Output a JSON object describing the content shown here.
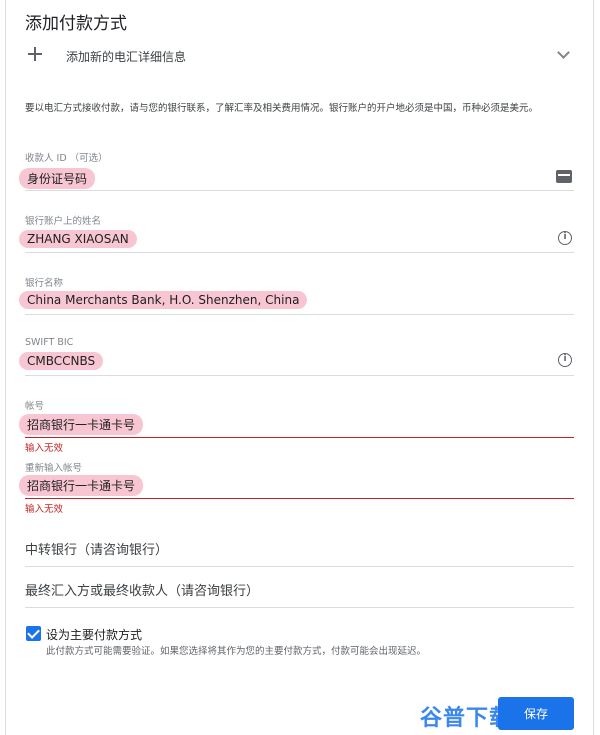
{
  "header": {
    "title": "添加付款方式"
  },
  "add_wire": {
    "label": "添加新的电汇详细信息"
  },
  "notice": "要以电汇方式接收付款，请与您的银行联系，了解汇率及相关费用情况。银行账户的开户地必须是中国，币种必须是美元。",
  "fields": {
    "payee_id": {
      "label": "收款人 ID （可选）",
      "value": "身份证号码"
    },
    "account_name": {
      "label": "银行账户上的姓名",
      "value": "ZHANG XIAOSAN"
    },
    "bank_name": {
      "label": "银行名称",
      "value": "China Merchants Bank, H.O. Shenzhen, China"
    },
    "swift": {
      "label": "SWIFT BIC",
      "value": "CMBCCNBS"
    },
    "account_number": {
      "label": "帐号",
      "value": "招商银行一卡通卡号",
      "error": "输入无效"
    },
    "account_number_confirm": {
      "label": "重新输入帐号",
      "value": "招商银行一卡通卡号",
      "error": "输入无效"
    }
  },
  "intermediary_bank": "中转银行（请咨询银行）",
  "final_beneficiary": "最终汇入方或最终收款人（请咨询银行）",
  "primary": {
    "label": "设为主要付款方式",
    "checked": true,
    "help": "此付款方式可能需要验证。如果您选择将其作为您的主要付款方式，付款可能会出现延迟。"
  },
  "save_button": "保存",
  "watermark": "谷普下载",
  "colors": {
    "accent": "#1a73e8",
    "error": "#c5221f",
    "highlight": "#f8c6d3"
  }
}
